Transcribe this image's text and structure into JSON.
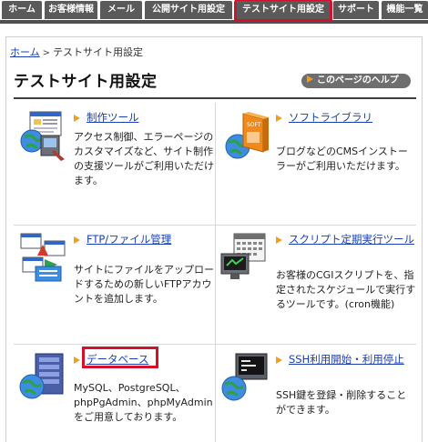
{
  "tabs": [
    {
      "label": "ホーム",
      "active": false
    },
    {
      "label": "お客様情報",
      "active": false
    },
    {
      "label": "メール",
      "active": false
    },
    {
      "label": "公開サイト用設定",
      "active": false
    },
    {
      "label": "テストサイト用設定",
      "active": true
    },
    {
      "label": "サポート",
      "active": false
    },
    {
      "label": "機能一覧",
      "active": false
    }
  ],
  "breadcrumb": {
    "home": "ホーム",
    "separator": ">",
    "current": "テストサイト用設定"
  },
  "page_title": "テストサイト用設定",
  "help_button": "このページのヘルプ",
  "items": [
    {
      "icon": "web-tools-icon",
      "title": "制作ツール",
      "description": "アクセス制御、エラーページのカスタマイズなど、サイト制作の支援ツールがご利用いただけます。"
    },
    {
      "icon": "software-library-icon",
      "title": "ソフトライブラリ",
      "description": "ブログなどのCMSインストーラーがご利用いただけます。"
    },
    {
      "icon": "ftp-file-manager-icon",
      "title": "FTP/ファイル管理",
      "description": "サイトにファイルをアップロードするための新しいFTPアカウントを追加します。"
    },
    {
      "icon": "script-scheduler-icon",
      "title": "スクリプト定期実行ツール",
      "description": "お客様のCGIスクリプトを、指定されたスケジュールで実行するツールです。(cron機能)"
    },
    {
      "icon": "database-icon",
      "title": "データベース",
      "description": "MySQL、PostgreSQL、phpPgAdmin、phpMyAdminをご用意しております。"
    },
    {
      "icon": "ssh-terminal-icon",
      "title": "SSH利用開始・利用停止",
      "description": "SSH鍵を登録・削除することができます。"
    }
  ],
  "colors": {
    "tab_bg": "#5a5a5a",
    "highlight": "#d3112b",
    "link": "#1a3fb0",
    "accent_arrow": "#f0a020"
  }
}
